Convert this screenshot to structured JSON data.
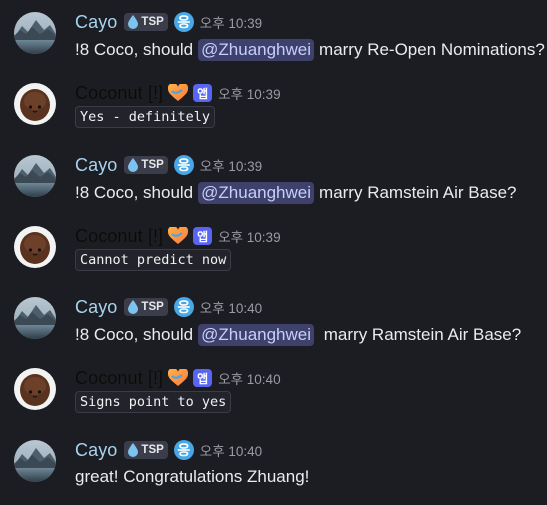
{
  "messages": [
    {
      "author": "Cayo",
      "tag": "TSP",
      "badge": "응",
      "time": "오후 10:39",
      "pre": "!8 Coco, should",
      "mention": "@Zhuanghwei",
      "post": "marry Re-Open Nominations?"
    },
    {
      "author": "Coconut [!]",
      "app_tag": "앱",
      "time": "오후 10:39",
      "code": "Yes - definitely"
    },
    {
      "author": "Cayo",
      "tag": "TSP",
      "badge": "응",
      "time": "오후 10:39",
      "pre": "!8 Coco, should",
      "mention": "@Zhuanghwei",
      "post": "marry Ramstein Air Base?"
    },
    {
      "author": "Coconut [!]",
      "app_tag": "앱",
      "time": "오후 10:39",
      "code": "Cannot predict now"
    },
    {
      "author": "Cayo",
      "tag": "TSP",
      "badge": "응",
      "time": "오후 10:40",
      "pre": "!8 Coco, should",
      "mention": "@Zhuanghwei",
      "post": " marry Ramstein Air Base?"
    },
    {
      "author": "Coconut [!]",
      "app_tag": "앱",
      "time": "오후 10:40",
      "code": "Signs point to yes"
    },
    {
      "author": "Cayo",
      "tag": "TSP",
      "badge": "응",
      "time": "오후 10:40",
      "text": "great! Congratulations Zhuang!"
    }
  ],
  "icons": {
    "cayo_avatar": "mountain-lake-avatar",
    "coconut_avatar": "coconut-avatar",
    "tag_icon": "water-drop-icon",
    "heart": "heart-icon"
  },
  "colors": {
    "background": "#1c1d22",
    "cayo_name": "#a7d3ee",
    "coconut_name": "#0a0a0a",
    "mention_bg": "#3d416c",
    "app_tag": "#5865f2"
  }
}
